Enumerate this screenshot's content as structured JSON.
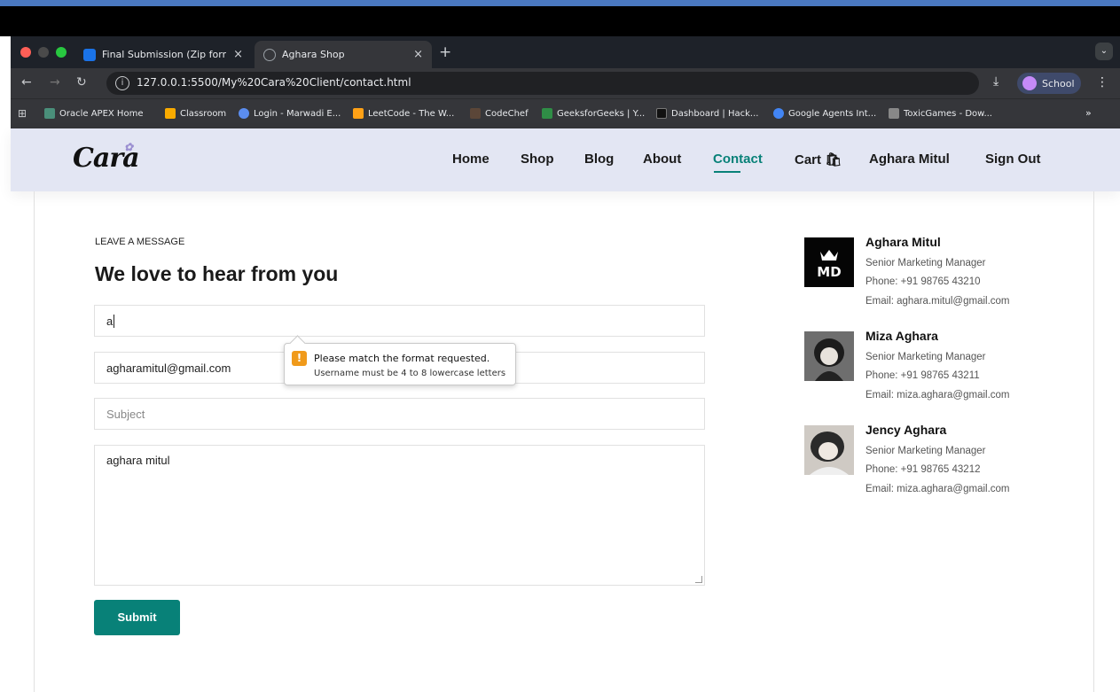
{
  "browser": {
    "tabs": [
      {
        "title": "Final Submission (Zip format",
        "favicon_color": "#1a73e8"
      },
      {
        "title": "Aghara Shop",
        "favicon_color": "#9aa0a6"
      }
    ],
    "close_glyph": "×",
    "new_tab_glyph": "+",
    "tab_menu_glyph": "⌄",
    "url": "127.0.0.1:5500/My%20Cara%20Client/contact.html",
    "profile_label": "School",
    "bookmarks": [
      {
        "label": "Oracle APEX Home",
        "color": "#4a8f7a"
      },
      {
        "label": "Classroom",
        "color": "#f9ab00"
      },
      {
        "label": "Login - Marwadi E...",
        "color": "#5b8def"
      },
      {
        "label": "LeetCode - The W...",
        "color": "#ffa116"
      },
      {
        "label": "CodeChef",
        "color": "#5b4638"
      },
      {
        "label": "GeeksforGeeks | Y...",
        "color": "#2f8d46"
      },
      {
        "label": "Dashboard | Hack...",
        "color": "#111111"
      },
      {
        "label": "Google Agents Int...",
        "color": "#4285f4"
      },
      {
        "label": "ToxicGames - Dow...",
        "color": "#888888"
      }
    ],
    "more_glyph": "»"
  },
  "site": {
    "logo": "Cara",
    "nav": [
      {
        "label": "Home",
        "active": false
      },
      {
        "label": "Shop",
        "active": false
      },
      {
        "label": "Blog",
        "active": false
      },
      {
        "label": "About",
        "active": false
      },
      {
        "label": "Contact",
        "active": true
      },
      {
        "label": "Cart 🛍",
        "active": false
      },
      {
        "label": "Aghara Mitul",
        "active": false
      },
      {
        "label": "Sign Out",
        "active": false
      }
    ],
    "accent": "#088178"
  },
  "form": {
    "kicker": "LEAVE A MESSAGE",
    "heading": "We love to hear from you",
    "name_value": "a",
    "email_value": "agharamitul@gmail.com",
    "subject_placeholder": "Subject",
    "message_value": "aghara mitul",
    "submit_label": "Submit"
  },
  "validation": {
    "icon": "!",
    "title": "Please match the format requested.",
    "message": "Username must be 4 to 8 lowercase letters"
  },
  "people": [
    {
      "name": "Aghara Mitul",
      "role": "Senior Marketing Manager",
      "phone": "Phone: +91 98765 43210",
      "email": "Email: aghara.mitul@gmail.com"
    },
    {
      "name": "Miza Aghara",
      "role": "Senior Marketing Manager",
      "phone": "Phone: +91 98765 43211",
      "email": "Email: miza.aghara@gmail.com"
    },
    {
      "name": "Jency Aghara",
      "role": "Senior Marketing Manager",
      "phone": "Phone: +91 98765 43212",
      "email": "Email: miza.aghara@gmail.com"
    }
  ]
}
